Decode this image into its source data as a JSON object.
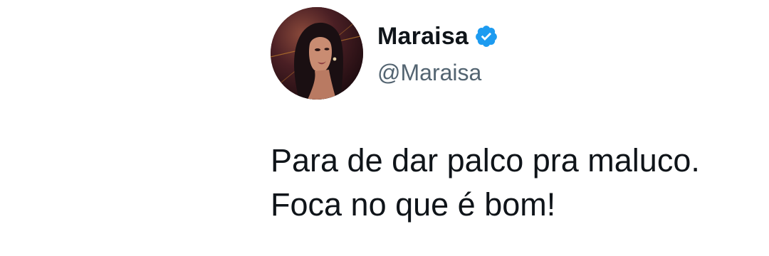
{
  "tweet": {
    "author": {
      "display_name": "Maraisa",
      "handle": "@Maraisa",
      "verified": true,
      "avatar_icon": "profile-photo"
    },
    "text_lines": [
      "Para de dar palco pra maluco.",
      "Foca no que é bom!"
    ],
    "colors": {
      "verified_badge": "#1d9bf0",
      "handle_text": "#536471",
      "main_text": "#0f1419"
    }
  }
}
